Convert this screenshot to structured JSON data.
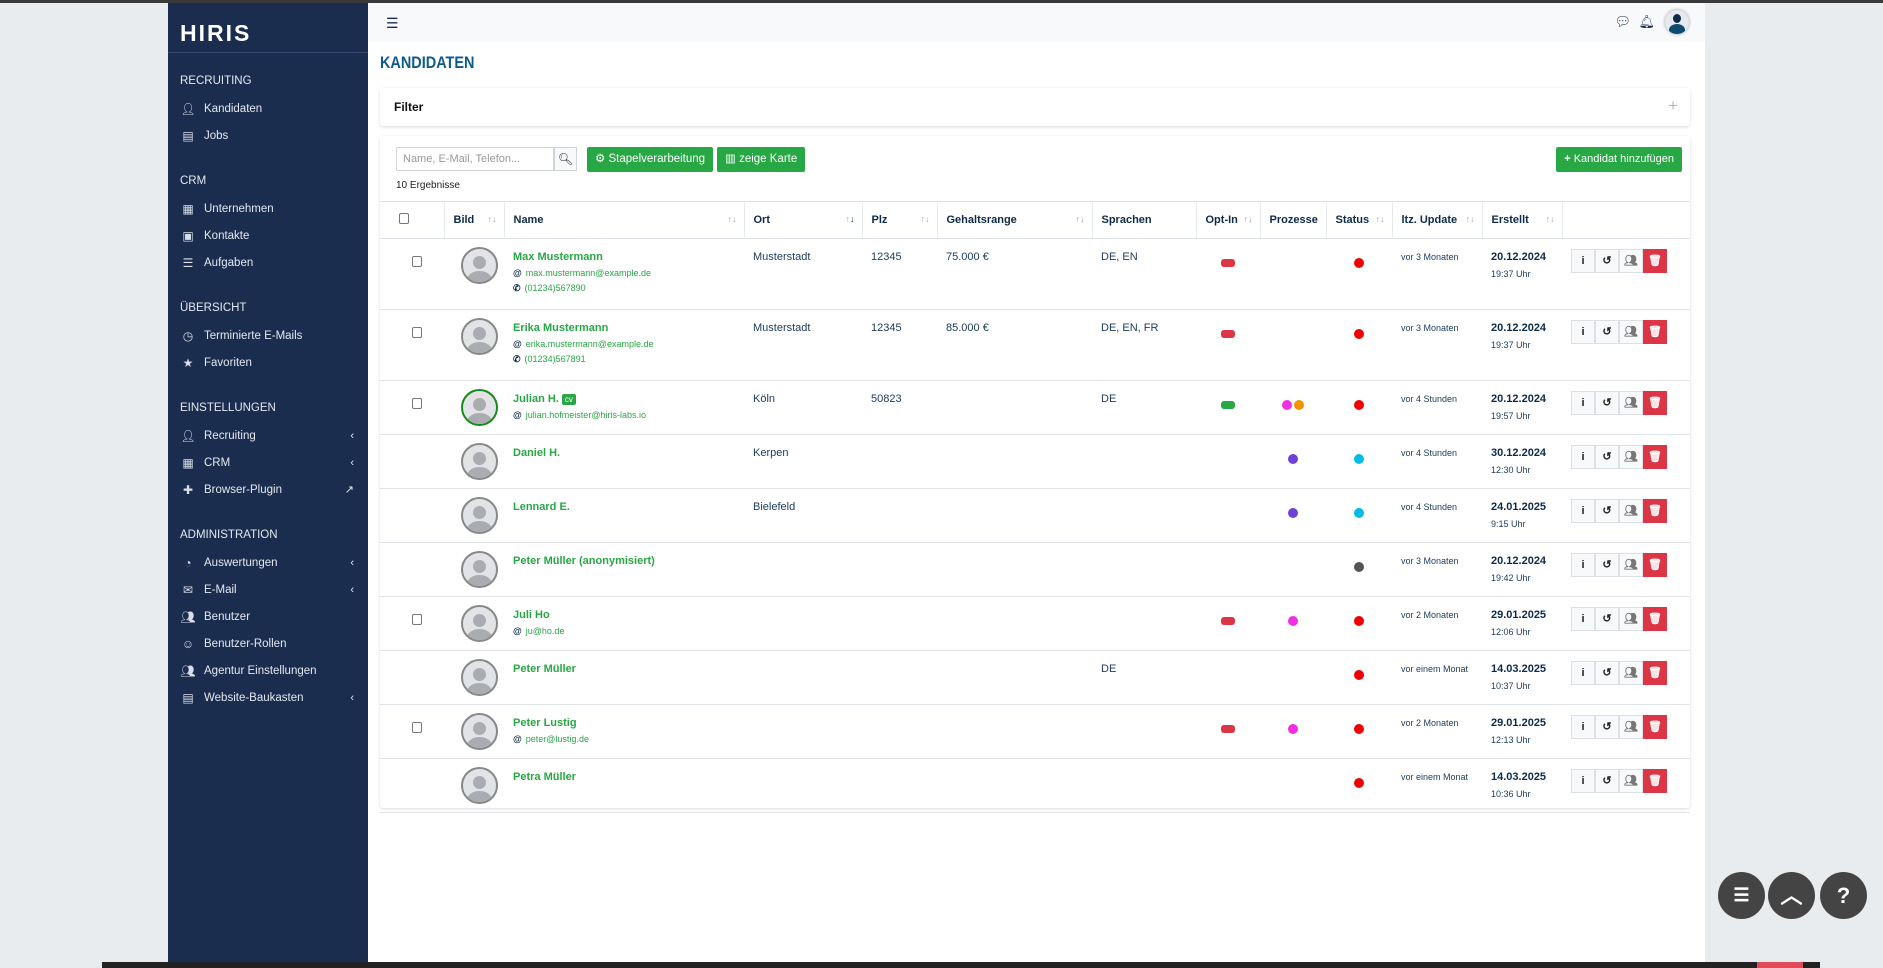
{
  "sidebar": {
    "logo": "HIRIS",
    "sections": [
      {
        "title": "RECRUITING",
        "items": [
          {
            "label": "Kandidaten",
            "icon": "user-tie-icon"
          },
          {
            "label": "Jobs",
            "icon": "id-card-icon"
          }
        ]
      },
      {
        "title": "CRM",
        "items": [
          {
            "label": "Unternehmen",
            "icon": "building-icon"
          },
          {
            "label": "Kontakte",
            "icon": "address-book-icon"
          },
          {
            "label": "Aufgaben",
            "icon": "tasks-icon"
          }
        ]
      },
      {
        "title": "ÜBERSICHT",
        "items": [
          {
            "label": "Terminierte E-Mails",
            "icon": "clock-icon"
          },
          {
            "label": "Favoriten",
            "icon": "star-icon"
          }
        ]
      },
      {
        "title": "EINSTELLUNGEN",
        "items": [
          {
            "label": "Recruiting",
            "icon": "user-tie-icon",
            "chevron": true
          },
          {
            "label": "CRM",
            "icon": "building-icon",
            "chevron": true
          },
          {
            "label": "Browser-Plugin",
            "icon": "puzzle-icon",
            "external": true
          }
        ]
      },
      {
        "title": "ADMINISTRATION",
        "items": [
          {
            "label": "Auswertungen",
            "icon": "pie-chart-icon",
            "chevron": true
          },
          {
            "label": "E-Mail",
            "icon": "envelope-icon",
            "chevron": true
          },
          {
            "label": "Benutzer",
            "icon": "users-icon"
          },
          {
            "label": "Benutzer-Rollen",
            "icon": "user-role-icon"
          },
          {
            "label": "Agentur Einstellungen",
            "icon": "users-icon"
          },
          {
            "label": "Website-Baukasten",
            "icon": "warehouse-icon",
            "chevron": true
          }
        ]
      }
    ]
  },
  "header": {
    "title": "KANDIDATEN"
  },
  "filter": {
    "label": "Filter"
  },
  "toolbar": {
    "search_placeholder": "Name, E-Mail, Telefon...",
    "batch_label": "Stapelverarbeitung",
    "map_label": "zeige Karte",
    "add_label": "Kandidat hinzufügen",
    "results": "10 Ergebnisse"
  },
  "colors": {
    "sidebar": "#1b2d4f",
    "accent": "#28a745",
    "danger": "#dc3545",
    "optin_red": "#dc3545",
    "optin_green": "#28a745"
  },
  "table": {
    "columns": [
      "Bild",
      "Name",
      "Ort",
      "Plz",
      "Gehaltsrange",
      "Sprachen",
      "Opt-In",
      "Prozesse",
      "Status",
      "ltz. Update",
      "Erstellt"
    ],
    "rows": [
      {
        "checkbox": true,
        "name": "Max Mustermann",
        "email": "max.mustermann@example.de",
        "phone": "(01234)567890",
        "ort": "Musterstadt",
        "plz": "12345",
        "gehalt": "75.000 €",
        "sprachen": "DE, EN",
        "optin": "red",
        "prozesse": [],
        "status": "#f00000",
        "update": "vor 3 Monaten",
        "date": "20.12.2024",
        "time": "19:37 Uhr"
      },
      {
        "checkbox": true,
        "name": "Erika Mustermann",
        "email": "erika.mustermann@example.de",
        "phone": "(01234)567891",
        "ort": "Musterstadt",
        "plz": "12345",
        "gehalt": "85.000 €",
        "sprachen": "DE, EN, FR",
        "optin": "red",
        "prozesse": [],
        "status": "#f00000",
        "update": "vor 3 Monaten",
        "date": "20.12.2024",
        "time": "19:37 Uhr"
      },
      {
        "checkbox": true,
        "name": "Julian H.",
        "cv": "cv",
        "avatar_green": true,
        "email": "julian.hofmeister@hiris-labs.io",
        "ort": "Köln",
        "plz": "50823",
        "sprachen": "DE",
        "optin": "green",
        "prozesse": [
          "#f02fe0",
          "#f59300"
        ],
        "status": "#f00000",
        "update": "vor 4 Stunden",
        "date": "20.12.2024",
        "time": "19:57 Uhr"
      },
      {
        "name": "Daniel H.",
        "ort": "Kerpen",
        "prozesse": [
          "#6f42d6"
        ],
        "status": "#00bce6",
        "update": "vor 4 Stunden",
        "date": "30.12.2024",
        "time": "12:30 Uhr"
      },
      {
        "name": "Lennard E.",
        "ort": "Bielefeld",
        "prozesse": [
          "#6f42d6"
        ],
        "status": "#00bce6",
        "update": "vor 4 Stunden",
        "date": "24.01.2025",
        "time": "9:15 Uhr"
      },
      {
        "name": "Peter Müller (anonymisiert)",
        "prozesse": [],
        "status": "#555555",
        "update": "vor 3 Monaten",
        "date": "20.12.2024",
        "time": "19:42 Uhr"
      },
      {
        "checkbox": true,
        "name": "Juli Ho",
        "email": "ju@ho.de",
        "optin": "red",
        "prozesse": [
          "#f02fe0"
        ],
        "status": "#f00000",
        "update": "vor 2 Monaten",
        "date": "29.01.2025",
        "time": "12:06 Uhr"
      },
      {
        "name": "Peter Müller",
        "sprachen": "DE",
        "prozesse": [],
        "status": "#f00000",
        "update": "vor einem Monat",
        "date": "14.03.2025",
        "time": "10:37 Uhr"
      },
      {
        "checkbox": true,
        "name": "Peter Lustig",
        "email": "peter@lustig.de",
        "optin": "red",
        "prozesse": [
          "#f02fe0"
        ],
        "status": "#f00000",
        "update": "vor 2 Monaten",
        "date": "29.01.2025",
        "time": "12:13 Uhr"
      },
      {
        "name": "Petra Müller",
        "prozesse": [],
        "status": "#f00000",
        "update": "vor einem Monat",
        "date": "14.03.2025",
        "time": "10:36 Uhr"
      }
    ]
  }
}
